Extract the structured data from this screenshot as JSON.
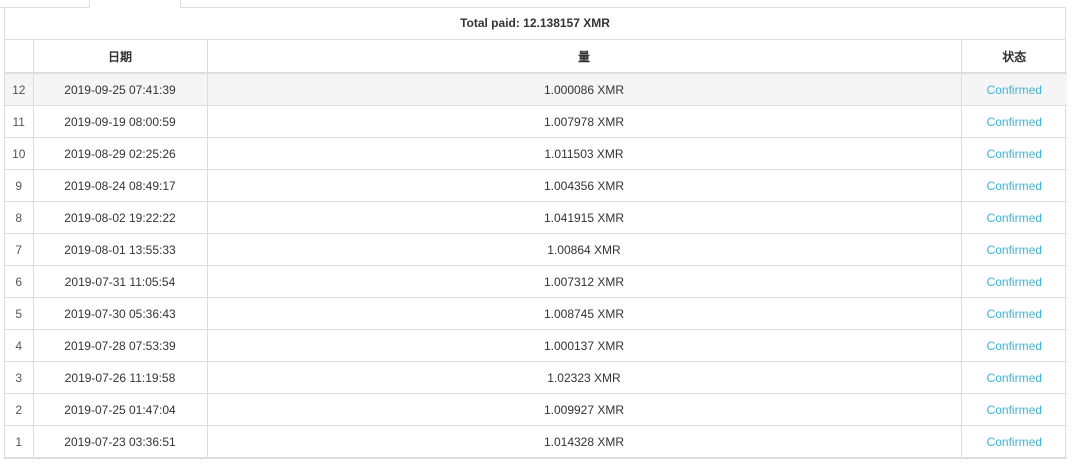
{
  "summary": {
    "total_paid": "Total paid: 12.138157 XMR"
  },
  "table": {
    "headers": {
      "num": "",
      "date": "日期",
      "amount": "量",
      "status": "状态"
    },
    "rows": [
      {
        "num": "12",
        "date": "2019-09-25 07:41:39",
        "amount": "1.000086 XMR",
        "status": "Confirmed"
      },
      {
        "num": "11",
        "date": "2019-09-19 08:00:59",
        "amount": "1.007978 XMR",
        "status": "Confirmed"
      },
      {
        "num": "10",
        "date": "2019-08-29 02:25:26",
        "amount": "1.011503 XMR",
        "status": "Confirmed"
      },
      {
        "num": "9",
        "date": "2019-08-24 08:49:17",
        "amount": "1.004356 XMR",
        "status": "Confirmed"
      },
      {
        "num": "8",
        "date": "2019-08-02 19:22:22",
        "amount": "1.041915 XMR",
        "status": "Confirmed"
      },
      {
        "num": "7",
        "date": "2019-08-01 13:55:33",
        "amount": "1.00864 XMR",
        "status": "Confirmed"
      },
      {
        "num": "6",
        "date": "2019-07-31 11:05:54",
        "amount": "1.007312 XMR",
        "status": "Confirmed"
      },
      {
        "num": "5",
        "date": "2019-07-30 05:36:43",
        "amount": "1.008745 XMR",
        "status": "Confirmed"
      },
      {
        "num": "4",
        "date": "2019-07-28 07:53:39",
        "amount": "1.000137 XMR",
        "status": "Confirmed"
      },
      {
        "num": "3",
        "date": "2019-07-26 11:19:58",
        "amount": "1.02323 XMR",
        "status": "Confirmed"
      },
      {
        "num": "2",
        "date": "2019-07-25 01:47:04",
        "amount": "1.009927 XMR",
        "status": "Confirmed"
      },
      {
        "num": "1",
        "date": "2019-07-23 03:36:51",
        "amount": "1.014328 XMR",
        "status": "Confirmed"
      }
    ]
  },
  "colors": {
    "status_confirmed": "#3fb3d5",
    "border": "#dddddd",
    "highlight_row": "#f5f5f5"
  }
}
